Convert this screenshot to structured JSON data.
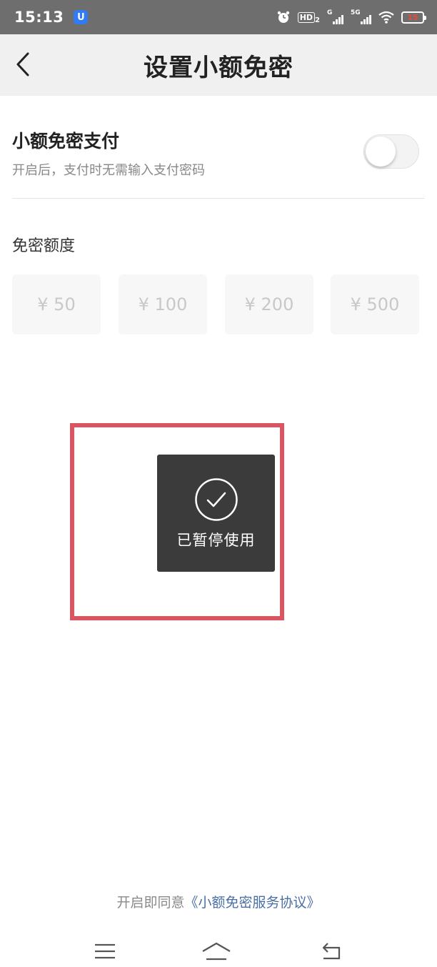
{
  "status_bar": {
    "time": "15:13",
    "app_badge": "U",
    "hd_label": "HD",
    "hd_sub": "2",
    "signal1_tag": "G",
    "signal2_tag": "5G",
    "battery_level": "15"
  },
  "nav": {
    "title": "设置小额免密"
  },
  "setting": {
    "title": "小额免密支付",
    "description": "开启后，支付时无需输入支付密码",
    "toggle_on": false
  },
  "amount": {
    "label": "免密额度",
    "options": [
      "¥ 50",
      "¥ 100",
      "¥ 200",
      "¥ 500"
    ]
  },
  "toast": {
    "message": "已暂停使用"
  },
  "agreement": {
    "prefix": "开启即同意",
    "link": "《小额免密服务协议》"
  },
  "colors": {
    "status_bar_bg": "#6e6e6e",
    "nav_bg": "#f0f0f0",
    "link": "#4a6fa5",
    "highlight": "#d85661",
    "toast_bg": "#3b3b3b"
  }
}
